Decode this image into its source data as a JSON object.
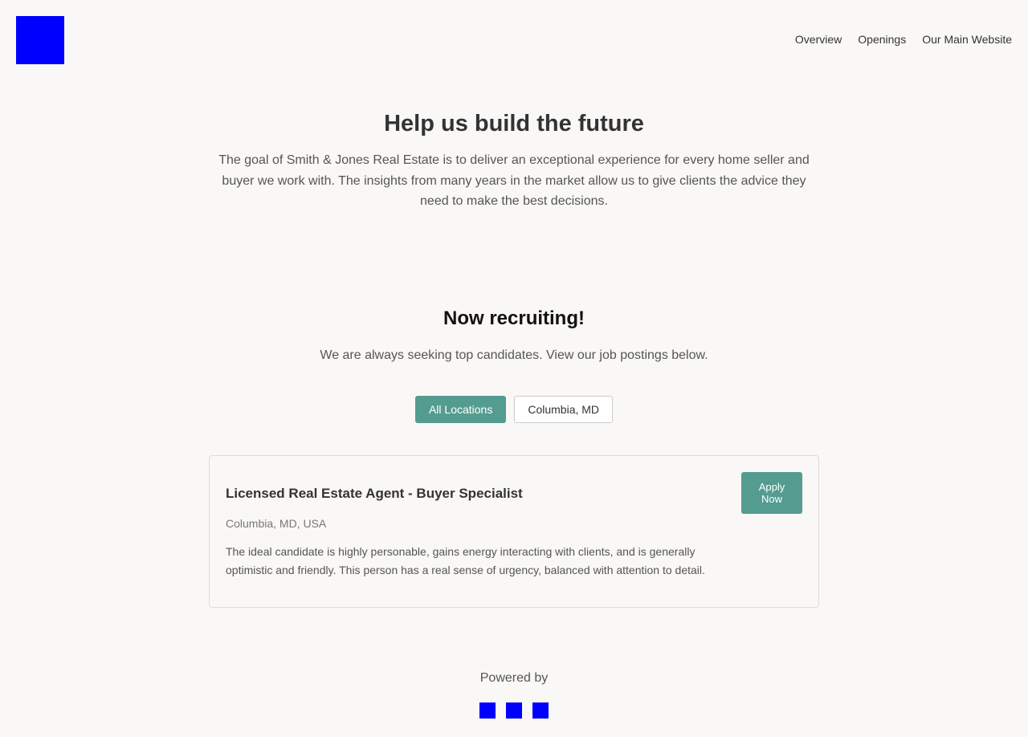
{
  "header": {
    "logo_icon": "company-logo-icon",
    "nav": [
      {
        "label": "Overview"
      },
      {
        "label": "Openings"
      },
      {
        "label": "Our Main Website"
      }
    ]
  },
  "hero": {
    "title": "Help us build the future",
    "description": "The goal of Smith & Jones Real Estate is to deliver an exceptional experience for every home seller and buyer we work with. The insights from many years in the market allow us to give clients the advice they need to make the best decisions."
  },
  "recruiting": {
    "title": "Now recruiting!",
    "subtitle": "We are always seeking top candidates. View our job postings below."
  },
  "filters": [
    {
      "label": "All Locations",
      "active": true
    },
    {
      "label": "Columbia, MD",
      "active": false
    }
  ],
  "jobs": [
    {
      "title": "Licensed Real Estate Agent - Buyer Specialist",
      "location": "Columbia, MD, USA",
      "description": "The ideal candidate is highly personable, gains energy interacting with clients, and is generally optimistic and friendly. This person has a real sense of urgency, balanced with attention to detail.",
      "apply_label": "Apply Now"
    }
  ],
  "footer": {
    "powered_by": "Powered by",
    "icons": [
      "social-icon-1",
      "social-icon-2",
      "social-icon-3"
    ]
  },
  "colors": {
    "accent": "#549c8f",
    "logo_placeholder": "#0000ff",
    "background": "#f9f8f6"
  }
}
